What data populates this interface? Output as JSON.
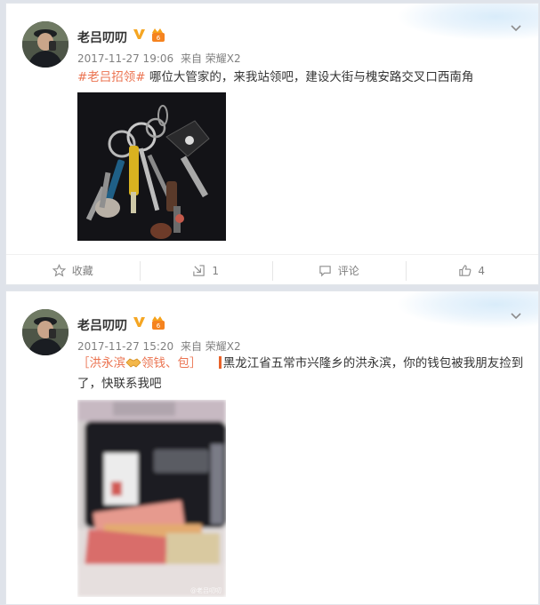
{
  "posts": [
    {
      "user": {
        "name": "老吕叨叨",
        "verified_icon": "verified-v-icon",
        "member_icon": "vip-member-icon"
      },
      "time": "2017-11-27 19:06",
      "source": "来自 荣耀X2",
      "hashtag": "#老吕招领#",
      "text": " 哪位大管家的，来我站领吧，建设大街与槐安路交叉口西南角",
      "image_label": "keys-photo",
      "actions": {
        "favorite": "收藏",
        "repost": "1",
        "comment": "评论",
        "like": "4"
      }
    },
    {
      "user": {
        "name": "老吕叨叨",
        "verified_icon": "verified-v-icon",
        "member_icon": "vip-member-icon"
      },
      "time": "2017-11-27 15:20",
      "source": "来自 荣耀X2",
      "topic_prefix": "［洪永滨",
      "topic_suffix": "领钱、包］",
      "text": "黑龙江省五常市兴隆乡的洪永滨，你的钱包被我朋友捡到了，快联系我吧",
      "image_watermark": "@老吕叨叨"
    }
  ],
  "colors": {
    "link": "#eb7350",
    "meta": "#808080",
    "page_bg": "#dfe3ea"
  }
}
